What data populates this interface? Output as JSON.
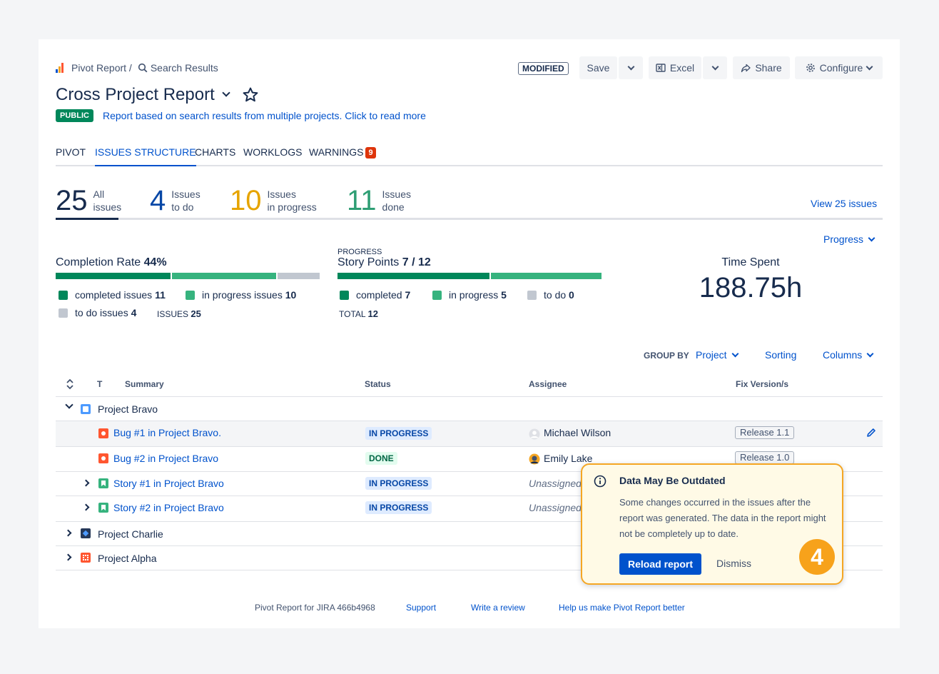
{
  "breadcrumb": {
    "root": "Pivot Report /",
    "current": "Search Results"
  },
  "toolbar": {
    "modified": "MODIFIED",
    "save": "Save",
    "excel": "Excel",
    "share": "Share",
    "configure": "Configure"
  },
  "report": {
    "title": "Cross Project Report",
    "visibility": "PUBLIC",
    "description": "Report based on search results from multiple projects. Click to read more"
  },
  "tabs": [
    {
      "label": "PIVOT"
    },
    {
      "label": "ISSUES STRUCTURE"
    },
    {
      "label": "CHARTS"
    },
    {
      "label": "WORKLOGS"
    },
    {
      "label": "WARNINGS",
      "badge": "9"
    }
  ],
  "stats": [
    {
      "num": "25",
      "l1": "All",
      "l2": "issues",
      "color": "#172b4d"
    },
    {
      "num": "4",
      "l1": "Issues",
      "l2": "to do",
      "color": "#0747a6"
    },
    {
      "num": "10",
      "l1": "Issues",
      "l2": "in progress",
      "color": "#e6a400"
    },
    {
      "num": "11",
      "l1": "Issues",
      "l2": "done",
      "color": "#2f9e74"
    }
  ],
  "view_issues": "View 25 issues",
  "progress_menu": "Progress",
  "completion": {
    "label": "Completion Rate",
    "value": "44%",
    "completed_label": "completed issues",
    "completed": "11",
    "inprog_label": "in progress issues",
    "inprog": "10",
    "todo_label": "to do issues",
    "todo": "4",
    "total_label": "ISSUES",
    "total": "25"
  },
  "story_points": {
    "caption": "PROGRESS",
    "label": "Story Points",
    "value": "7 / 12",
    "completed_label": "completed",
    "completed": "7",
    "inprog_label": "in progress",
    "inprog": "5",
    "todo_label": "to do",
    "todo": "0",
    "total_label": "TOTAL",
    "total": "12"
  },
  "time_spent": {
    "label": "Time Spent",
    "value": "188.75h"
  },
  "group_bar": {
    "group_by": "GROUP BY",
    "group_value": "Project",
    "sorting": "Sorting",
    "columns": "Columns"
  },
  "table": {
    "headers": {
      "type": "T",
      "summary": "Summary",
      "status": "Status",
      "assignee": "Assignee",
      "fix": "Fix Version/s"
    },
    "groups": {
      "bravo": "Project Bravo",
      "charlie": "Project Charlie",
      "alpha": "Project Alpha"
    },
    "rows": [
      {
        "summary": "Bug #1 in Project Bravo.",
        "status": "IN PROGRESS",
        "assignee": "Michael Wilson",
        "version": "Release 1.1"
      },
      {
        "summary": "Bug #2 in Project Bravo",
        "status": "DONE",
        "assignee": "Emily Lake",
        "version": "Release 1.0"
      },
      {
        "summary": "Story #1 in Project Bravo",
        "status": "IN PROGRESS",
        "assignee": "Unassigned"
      },
      {
        "summary": "Story #2 in Project Bravo",
        "status": "IN PROGRESS",
        "assignee": "Unassigned"
      }
    ]
  },
  "popup": {
    "title": "Data May Be Outdated",
    "body": "Some changes occurred in the issues after the report was generated. The data in the report might not be completely up to date.",
    "reload": "Reload report",
    "dismiss": "Dismiss",
    "step": "4"
  },
  "footer": {
    "product": "Pivot Report for JIRA 466b4968",
    "support": "Support",
    "review": "Write a review",
    "better": "Help us make Pivot Report better"
  }
}
